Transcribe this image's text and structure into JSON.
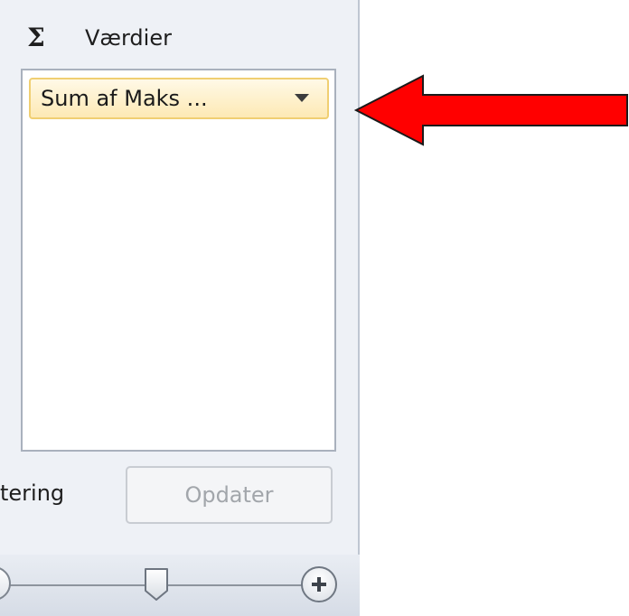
{
  "values_section": {
    "icon": "sigma-icon",
    "title": "Værdier",
    "fields": [
      {
        "label": "Sum af Maks ..."
      }
    ]
  },
  "footer": {
    "defer_label": "tering",
    "update_button": "Opdater"
  },
  "zoom": {
    "level": 0.5
  },
  "annotation": {
    "arrow_color": "#ff0000"
  }
}
